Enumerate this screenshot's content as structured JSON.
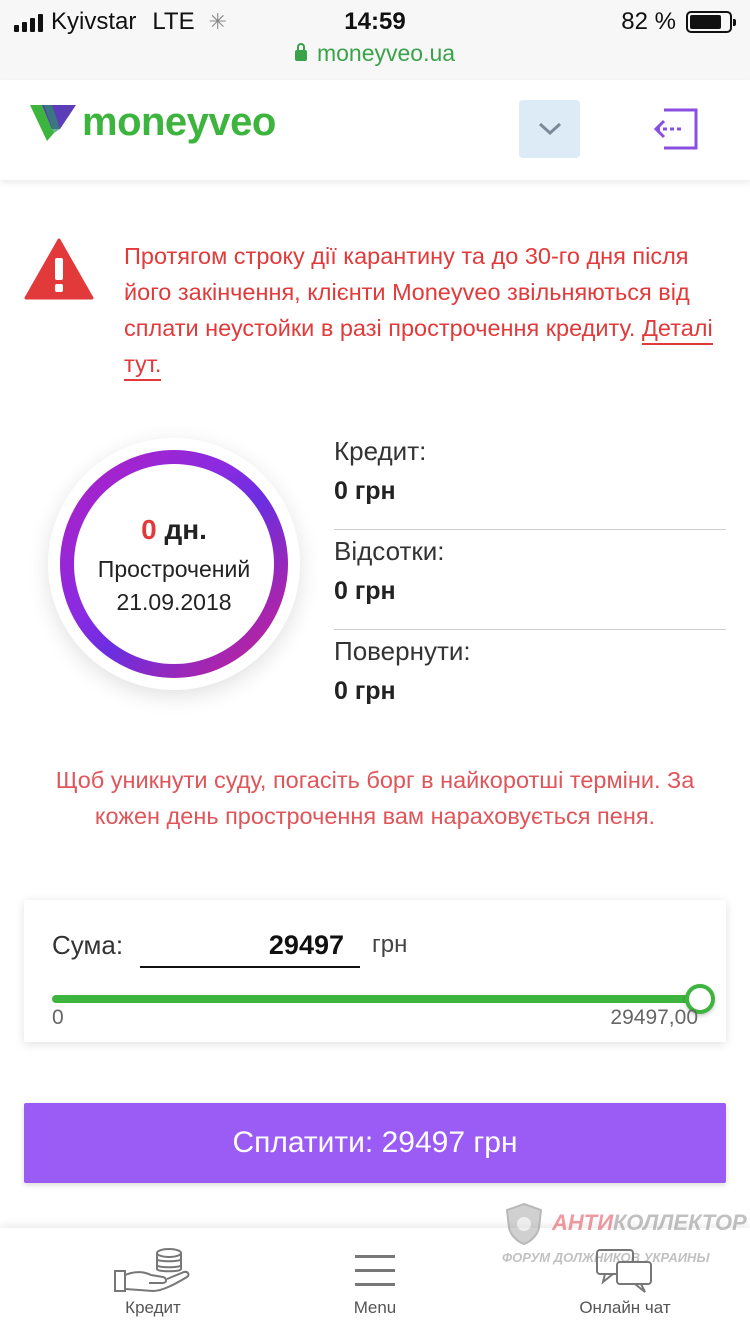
{
  "status_bar": {
    "carrier": "Kyivstar",
    "network": "LTE",
    "time": "14:59",
    "battery": "82 %",
    "battery_level": 0.82,
    "url": "moneyveo.ua"
  },
  "header": {
    "logo_text": "moneyveo"
  },
  "notice": {
    "text": "Протягом строку дії карантину та до 30-го дня після його закінчення, клієнти Moneyveo звільняються від сплати неустойки в разі прострочення кредиту.",
    "link": "Деталі тут."
  },
  "overdue": {
    "days_value": "0",
    "days_unit": "дн.",
    "label": "Прострочений",
    "date": "21.09.2018"
  },
  "loan": [
    {
      "label": "Кредит:",
      "value": "0 грн"
    },
    {
      "label": "Відсотки:",
      "value": "0 грн"
    },
    {
      "label": "Повернути:",
      "value": "0 грн"
    }
  ],
  "court_warning": "Щоб уникнути суду, погасіть борг в найкоротші терміни. За кожен день прострочення вам нараховується пеня.",
  "payment": {
    "sum_label": "Сума:",
    "sum_value": "29497",
    "currency": "грн",
    "slider_min": "0",
    "slider_max": "29497,00",
    "slider_fraction": 1.0,
    "pay_button": "Сплатити: 29497 грн"
  },
  "nav": [
    {
      "label": "Кредит",
      "icon": "credit-icon"
    },
    {
      "label": "Menu",
      "icon": "menu-icon"
    },
    {
      "label": "Онлайн чат",
      "icon": "chat-icon"
    }
  ],
  "watermark": {
    "title_red": "АНТИ",
    "title_rest": "КОЛЛЕКТОР",
    "subtitle": "ФОРУМ ДОЛЖНИКОВ УКРАИНЫ"
  },
  "colors": {
    "brand_green": "#3db43d",
    "alert_red": "#e23a3a",
    "pay_purple": "#9b5cf6"
  }
}
